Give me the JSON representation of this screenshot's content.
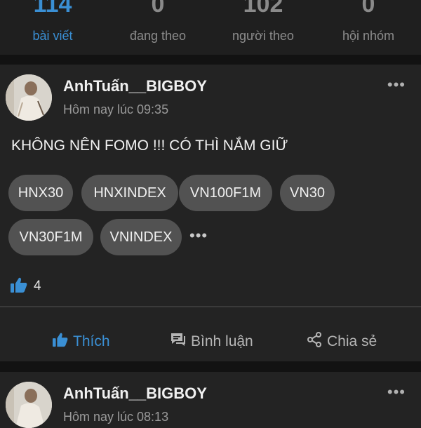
{
  "stats": [
    {
      "value": "114",
      "label": "bài viết"
    },
    {
      "value": "0",
      "label": "đang theo"
    },
    {
      "value": "102",
      "label": "người theo"
    },
    {
      "value": "0",
      "label": "hội nhóm"
    }
  ],
  "post1": {
    "author": "AnhTuấn__BIGBOY",
    "time": "Hôm nay lúc 09:35",
    "text": "KHÔNG NÊN FOMO !!! CÓ THÌ NẮM GIỮ",
    "tags": [
      "HNX30",
      "HNXINDEX",
      "VN100F1M",
      "VN30",
      "VN30F1M",
      "VNINDEX"
    ],
    "tags_more": "•••",
    "more_menu": "•••",
    "like_count": "4"
  },
  "actions": {
    "like": "Thích",
    "comment": "Bình luận",
    "share": "Chia sẻ"
  },
  "post2": {
    "author": "AnhTuấn__BIGBOY",
    "time": "Hôm nay lúc 08:13",
    "more_menu": "•••"
  },
  "colors": {
    "accent": "#3a8fd4",
    "background": "#121212",
    "card": "#232323",
    "tag": "#525252"
  },
  "icons": [
    "thumbs-up-icon",
    "comment-icon",
    "share-icon",
    "more-icon"
  ]
}
